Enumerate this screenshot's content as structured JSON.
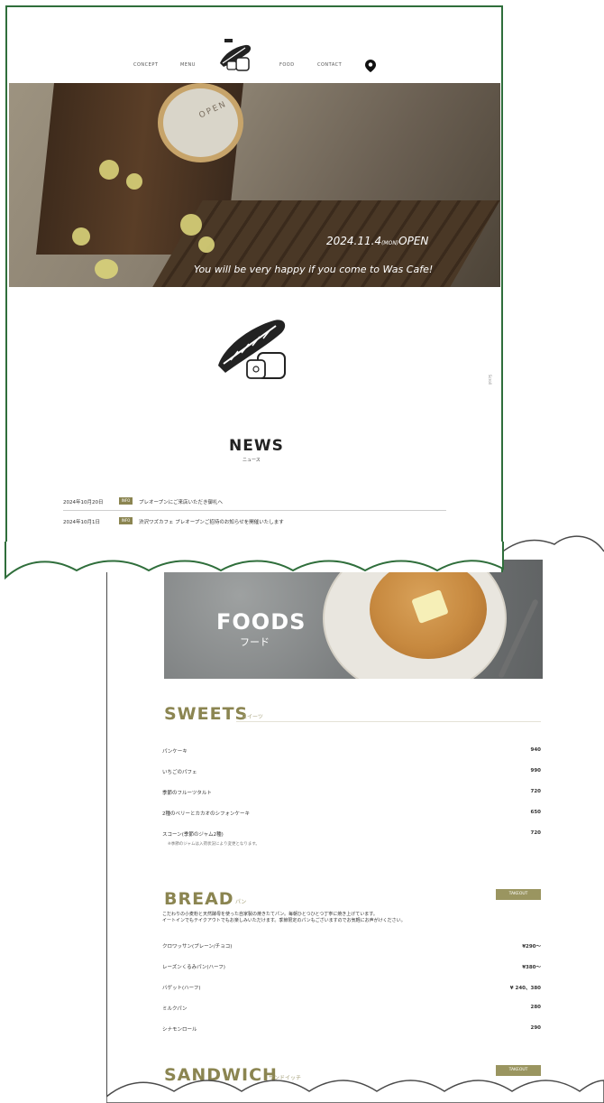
{
  "nav": {
    "items": [
      "CONCEPT",
      "MENU",
      "FOOD",
      "CONTACT"
    ]
  },
  "hero": {
    "sign_text": "OPEN",
    "open_date": "2024.11.4",
    "open_weekday": "(MON)",
    "open_label": "OPEN",
    "tagline": "You will be very happy if you come to Was Cafe!"
  },
  "side": {
    "scroll": "Scroll"
  },
  "news": {
    "title": "NEWS",
    "subtitle": "ニュース",
    "items": [
      {
        "date": "2024年10月20日",
        "tag": "INFO",
        "text": "プレオープンにご来店いただき御礼へ"
      },
      {
        "date": "2024年10月1日",
        "tag": "INFO",
        "text": "渋沢ワズカフェ プレオープンご招待のお知らせを開催いたします"
      }
    ]
  },
  "foods": {
    "title": "FOODS",
    "subtitle": "フード",
    "sections": {
      "sweets": {
        "title": "SWEETS",
        "subtitle": "スイーツ",
        "items": [
          {
            "name": "パンケーキ",
            "price": "940"
          },
          {
            "name": "いちごのパフェ",
            "price": "990"
          },
          {
            "name": "季節のフルーツタルト",
            "price": "720"
          },
          {
            "name": "2種のベリーとカカオのシフォンケーキ",
            "price": "650"
          },
          {
            "name": "スコーン(季節のジャム2種)",
            "price": "720"
          }
        ],
        "note": "※季節のジャムは入荷状況により変更となります。"
      },
      "bread": {
        "title": "BREAD",
        "subtitle": "パン",
        "takeout": "TAKEOUT",
        "description_1": "こだわりの小麦粉と天然酵母を使った自家製の焼きたてパン。毎朝ひとつひとつ丁寧に焼き上げています。",
        "description_2": "イートインでもテイクアウトでもお楽しみいただけます。季節限定のパンもございますのでお気軽にお声がけください。",
        "items": [
          {
            "name": "クロワッサン(プレーン/チョコ)",
            "price": "¥290〜"
          },
          {
            "name": "レーズンくるみパン(ハーフ)",
            "price": "¥380〜"
          },
          {
            "name": "バゲット(ハーフ)",
            "price": "¥ 240、380"
          },
          {
            "name": "ミルクパン",
            "price": "280"
          },
          {
            "name": "シナモンロール",
            "price": "290"
          }
        ]
      },
      "sandwich": {
        "title": "SANDWICH",
        "subtitle": "サンドイッチ",
        "takeout": "TAKEOUT"
      }
    }
  },
  "colors": {
    "frame_green": "#2f6e3b",
    "olive_accent": "#8b8551",
    "takeout_bg": "#9a9560"
  }
}
